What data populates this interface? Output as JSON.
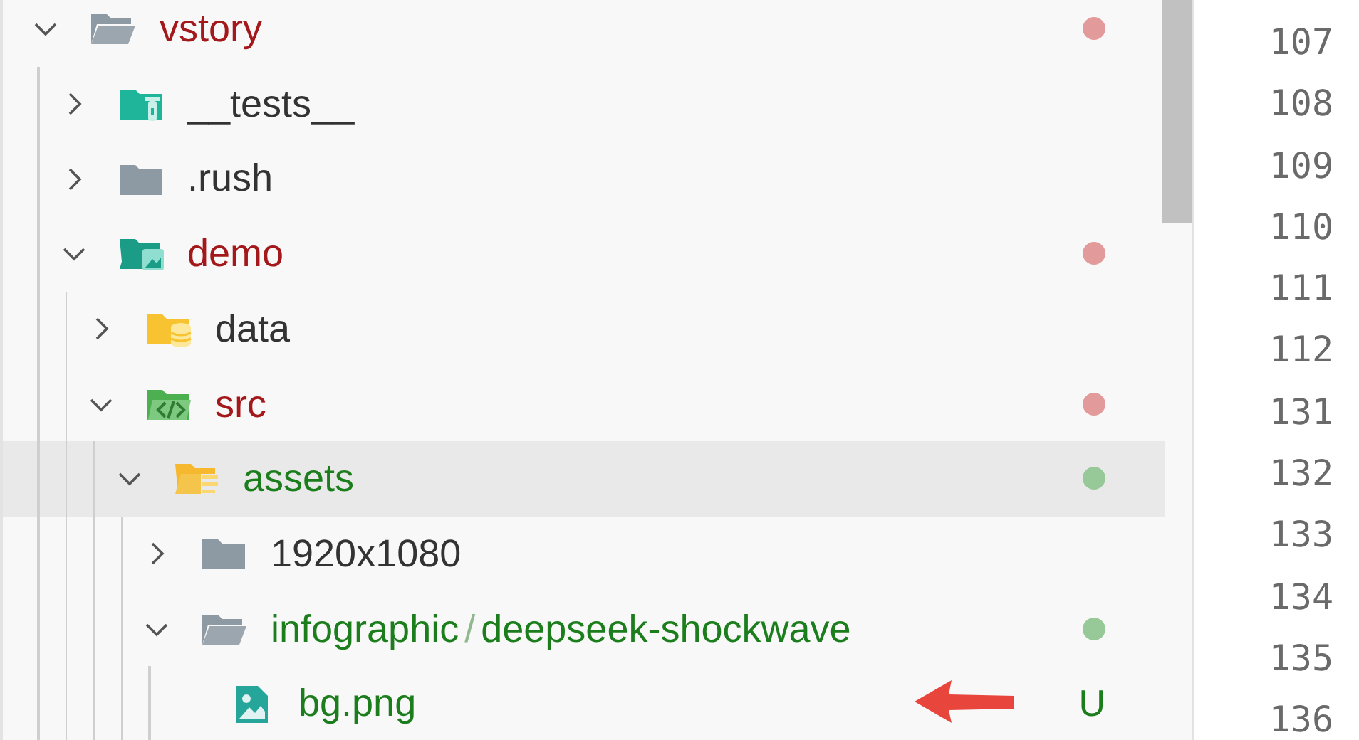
{
  "explorer": {
    "items": [
      {
        "name_parts": [
          "vstory"
        ],
        "kind": "open-folder",
        "expanded": true,
        "modified": true,
        "added": false,
        "hovered": false,
        "children": [
          {
            "name_parts": [
              "__tests__"
            ],
            "kind": "test-folder",
            "expanded": false,
            "modified": false,
            "added": false,
            "hovered": false
          },
          {
            "name_parts": [
              ".rush"
            ],
            "kind": "folder",
            "expanded": false,
            "modified": false,
            "added": false,
            "hovered": false
          },
          {
            "name_parts": [
              "demo"
            ],
            "kind": "image-folder",
            "expanded": true,
            "modified": true,
            "added": false,
            "hovered": false,
            "children": [
              {
                "name_parts": [
                  "data"
                ],
                "kind": "data-folder",
                "expanded": false,
                "modified": false,
                "added": false,
                "hovered": false
              },
              {
                "name_parts": [
                  "src"
                ],
                "kind": "code-folder",
                "expanded": true,
                "modified": true,
                "added": false,
                "hovered": false,
                "children": [
                  {
                    "name_parts": [
                      "assets"
                    ],
                    "kind": "assets-folder",
                    "expanded": true,
                    "modified": false,
                    "added": true,
                    "hovered": true,
                    "children": [
                      {
                        "name_parts": [
                          "1920x1080"
                        ],
                        "kind": "folder",
                        "expanded": false,
                        "modified": false,
                        "added": false,
                        "hovered": false
                      },
                      {
                        "name_parts": [
                          "infographic",
                          "/",
                          "deepseek-shockwave"
                        ],
                        "kind": "open-folder",
                        "expanded": true,
                        "modified": false,
                        "added": true,
                        "hovered": false,
                        "children": [
                          {
                            "name_parts": [
                              "bg.png"
                            ],
                            "kind": "image-file",
                            "modified": false,
                            "added": true,
                            "badge": "U",
                            "hovered": false
                          }
                        ]
                      }
                    ]
                  }
                ]
              }
            ]
          }
        ]
      }
    ]
  },
  "gutter": {
    "line_numbers": [
      "107",
      "108",
      "109",
      "110",
      "111",
      "112",
      "131",
      "132",
      "133",
      "134",
      "135",
      "136"
    ]
  }
}
